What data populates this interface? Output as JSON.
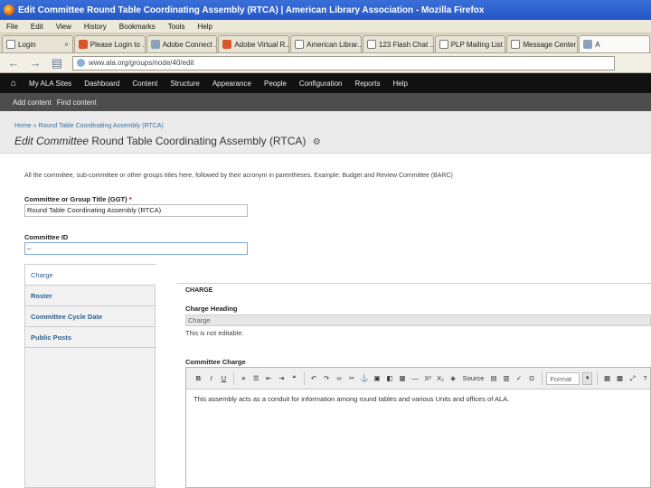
{
  "window": {
    "title": "Edit Committee Round Table Coordinating Assembly (RTCA) | American Library Association - Mozilla Firefox"
  },
  "menubar": [
    "File",
    "Edit",
    "View",
    "History",
    "Bookmarks",
    "Tools",
    "Help"
  ],
  "tabs": [
    {
      "label": "Login"
    },
    {
      "label": "Please Login to ..."
    },
    {
      "label": "Adobe Connect ..."
    },
    {
      "label": "Adobe Virtual R..."
    },
    {
      "label": "American Librar..."
    },
    {
      "label": "123 Flash Chat ..."
    },
    {
      "label": "PLP Mailing List ..."
    },
    {
      "label": "Message Center ..."
    },
    {
      "label": "A"
    }
  ],
  "nav": {
    "url": "www.ala.org/groups/node/40/edit"
  },
  "admin_toolbar": {
    "links": [
      "My ALA Sites",
      "Dashboard",
      "Content",
      "Structure",
      "Appearance",
      "People",
      "Configuration",
      "Reports",
      "Help"
    ],
    "shortcuts": [
      "Add content",
      "Find content"
    ]
  },
  "page": {
    "breadcrumb": "Home » Round Table Coordinating Assembly (RTCA)",
    "heading_italic": "Edit Committee",
    "heading_rest": "Round Table Coordinating Assembly (RTCA)"
  },
  "form": {
    "intro": "All the committee, sub-committee or other groups titles here, followed by their acronym in parentheses. Example: Budget and Review Committee (BARC)",
    "title_label": "Committee or Group Title (GGT)",
    "title_required": "*",
    "title_value": "Round Table Coordinating Assembly (RTCA)",
    "id_label": "Committee ID",
    "id_value": "–"
  },
  "vertical_tabs": [
    "Charge",
    "Roster",
    "Committee Cycle Date",
    "Public Posts"
  ],
  "charge_pane": {
    "title": "CHARGE",
    "heading_label": "Charge Heading",
    "heading_value": "Charge",
    "heading_help": "This is not editable.",
    "charge_label": "Committee Charge"
  },
  "editor": {
    "source_label": "Source",
    "format_label": "Format",
    "content": "This assembly acts as a conduit for information among round tables and various Units and offices of ALA."
  }
}
